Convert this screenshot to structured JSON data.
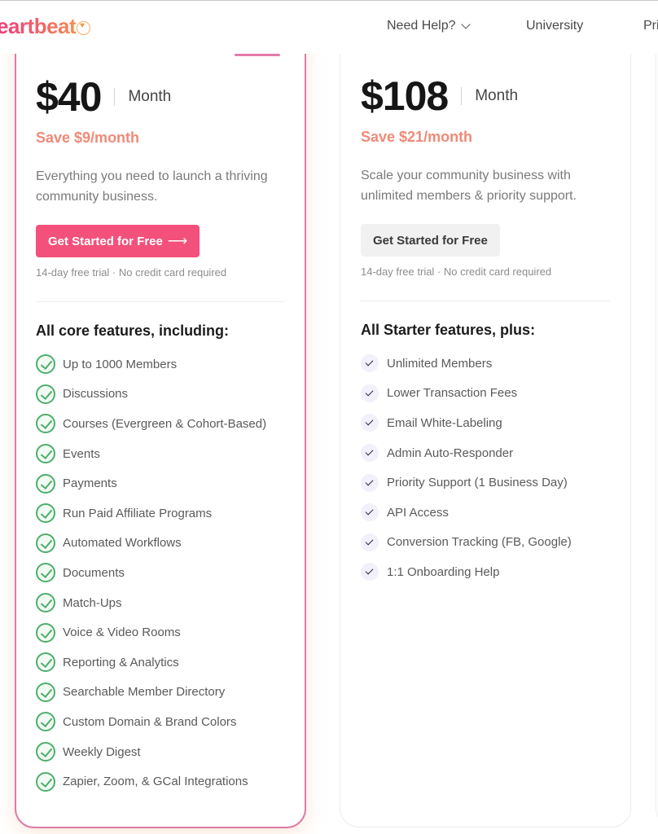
{
  "header": {
    "logo_text": "eartbeat",
    "nav": [
      {
        "label": "Need Help?",
        "has_dropdown": true
      },
      {
        "label": "University"
      },
      {
        "label": "Pri"
      }
    ]
  },
  "plans": [
    {
      "price": "$40",
      "period": "Month",
      "savings": "Save $9/month",
      "description": "Everything you need to launch a thriving community business.",
      "cta_label": "Get Started for Free",
      "cta_icon": "arrow-right-icon",
      "trial_note": "14-day free trial · No credit card required",
      "features_title": "All core features, including:",
      "features": [
        "Up to 1000 Members",
        "Discussions",
        "Courses (Evergreen & Cohort-Based)",
        "Events",
        "Payments",
        "Run Paid Affiliate Programs",
        "Automated Workflows",
        "Documents",
        "Match-Ups",
        "Voice & Video Rooms",
        "Reporting & Analytics",
        "Searchable Member Directory",
        "Custom Domain & Brand Colors",
        "Weekly Digest",
        "Zapier, Zoom, & GCal Integrations"
      ]
    },
    {
      "price": "$108",
      "period": "Month",
      "savings": "Save $21/month",
      "description": "Scale your community business with unlimited members & priority support.",
      "cta_label": "Get Started for Free",
      "trial_note": "14-day free trial · No credit card required",
      "features_title": "All Starter features, plus:",
      "features": [
        "Unlimited Members",
        "Lower Transaction Fees",
        "Email White-Labeling",
        "Admin Auto-Responder",
        "Priority Support (1 Business Day)",
        "API Access",
        "Conversion Tracking (FB, Google)",
        "1:1 Onboarding Help"
      ]
    }
  ],
  "colors": {
    "brand_pink": "#f3507b",
    "savings": "#f08a77",
    "check_green": "#4caf6b",
    "featured_border": "#e07aa6"
  }
}
